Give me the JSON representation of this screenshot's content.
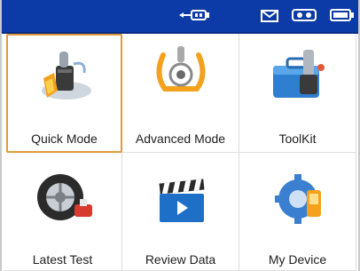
{
  "status_bar": {
    "icons": [
      "usb-icon",
      "mail-icon",
      "bluetooth-icon",
      "battery-icon"
    ],
    "background": "#0c3aa6"
  },
  "menu": {
    "selected": "Quick Mode",
    "accent": "#e09a3c",
    "items": [
      {
        "label": "Quick Mode",
        "icon": "tire-sensor-icon"
      },
      {
        "label": "Advanced Mode",
        "icon": "tpms-warning-icon"
      },
      {
        "label": "ToolKit",
        "icon": "toolkit-icon"
      },
      {
        "label": "Latest Test",
        "icon": "wheel-test-icon"
      },
      {
        "label": "Review Data",
        "icon": "clapperboard-icon"
      },
      {
        "label": "My Device",
        "icon": "device-gear-icon"
      }
    ]
  }
}
